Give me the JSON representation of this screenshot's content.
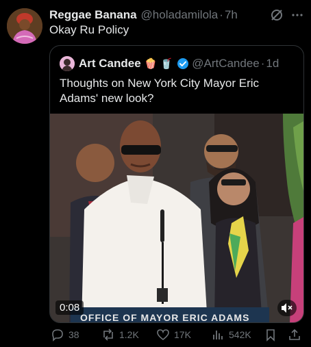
{
  "tweet": {
    "author_name": "Reggae Banana",
    "author_handle": "@holadamilola",
    "separator": "·",
    "time": "7h",
    "text": "Okay Ru Policy",
    "avatar_icon": "person-avatar"
  },
  "quote": {
    "author_name": "Art Candee",
    "emojis": "🍿 🥤",
    "author_handle": "@ArtCandee",
    "separator": "·",
    "time": "1d",
    "text": "Thoughts on New York City Mayor Eric Adams' new look?",
    "video": {
      "duration": "0:08",
      "banner_text": "OFFICE OF MAYOR ERIC ADAMS"
    }
  },
  "actions": {
    "replies": "38",
    "reposts": "1.2K",
    "likes": "17K",
    "views": "542K"
  },
  "colors": {
    "background": "#000000",
    "text": "#e7e9ea",
    "muted": "#71767b",
    "border": "#2f3336",
    "verified": "#1d9bf0"
  }
}
